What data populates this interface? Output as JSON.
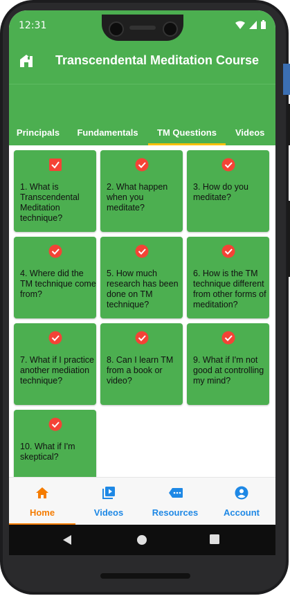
{
  "status_bar": {
    "time": "12:31"
  },
  "app_bar": {
    "title": "Transcendental Meditation Course"
  },
  "tabs": [
    {
      "label": "Principals",
      "active": false
    },
    {
      "label": "Fundamentals",
      "active": false
    },
    {
      "label": "TM Questions",
      "active": true
    },
    {
      "label": "Videos",
      "active": false
    }
  ],
  "questions": [
    {
      "text": "1. What is Transcendental Meditation technique?",
      "icon": "checkbox-checked-icon"
    },
    {
      "text": "2. What happen when you meditate?",
      "icon": "check-circle-icon"
    },
    {
      "text": "3. How do you meditate?",
      "icon": "check-circle-icon"
    },
    {
      "text": "4. Where did the TM technique come from?",
      "icon": "check-circle-icon"
    },
    {
      "text": "5. How much research has been done on TM technique?",
      "icon": "check-circle-icon"
    },
    {
      "text": "6. How is the TM technique different from other forms of meditation?",
      "icon": "check-circle-icon"
    },
    {
      "text": "7. What if I practice another mediation technique?",
      "icon": "check-circle-icon"
    },
    {
      "text": "8. Can I learn TM from a book or video?",
      "icon": "check-circle-icon"
    },
    {
      "text": "9. What if I'm not good at controlling my mind?",
      "icon": "check-circle-icon"
    },
    {
      "text": "10. What if I'm skeptical?",
      "icon": "check-circle-icon"
    }
  ],
  "bottom_nav": [
    {
      "label": "Home",
      "icon": "home-icon",
      "active": true
    },
    {
      "label": "Videos",
      "icon": "video-library-icon",
      "active": false
    },
    {
      "label": "Resources",
      "icon": "resources-icon",
      "active": false
    },
    {
      "label": "Account",
      "icon": "account-icon",
      "active": false
    }
  ],
  "colors": {
    "primary": "#4caf50",
    "tab_indicator": "#ffc107",
    "check": "#f44336",
    "nav_active": "#f57c00",
    "nav_inactive": "#1e88e5"
  }
}
